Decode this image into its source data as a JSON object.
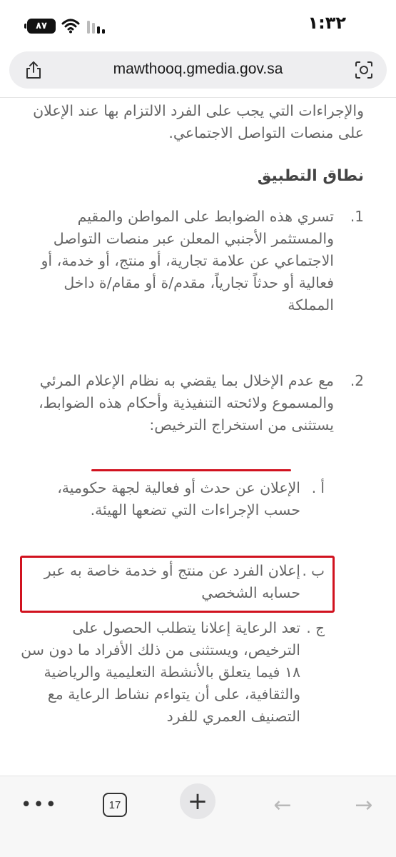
{
  "status": {
    "time": "١:٣٢",
    "battery": "٨٧"
  },
  "browser": {
    "url": "mawthooq.gmedia.gov.sa",
    "tab_count": "17",
    "more_label": "•••",
    "new_tab_label": "+",
    "back_label": "←",
    "forward_label": "→"
  },
  "article": {
    "intro": "والإجراءات التي يجب على الفرد الالتزام بها عند الإعلان على منصات التواصل الاجتماعي.",
    "heading": "نطاق التطبيق",
    "items": [
      {
        "num": "1.",
        "text": "تسري هذه الضوابط على المواطن والمقيم والمستثمر الأجنبي المعلن عبر منصات التواصل الاجتماعي عن علامة تجارية، أو منتج، أو خدمة، أو فعالية أو حدثاً تجارياً، مقدم/ة أو مقام/ة داخل المملكة"
      },
      {
        "num": "2.",
        "text": "مع عدم الإخلال بما يقضي به نظام الإعلام المرئي والمسموع ولائحته التنفيذية وأحكام هذه الضوابط، يستثنى من استخراج الترخيص:"
      }
    ],
    "sub_items": [
      {
        "num": "أ .",
        "text": "الإعلان عن حدث أو فعالية لجهة حكومية، حسب الإجراءات التي تضعها الهيئة."
      },
      {
        "num": "ب .",
        "text": "إعلان الفرد عن منتج أو خدمة خاصة به عبر حسابه الشخصي"
      },
      {
        "num": "ج .",
        "text": "تعد الرعاية إعلانا يتطلب الحصول على الترخيص، ويستثنى من ذلك الأفراد ما دون سن ١٨ فيما يتعلق بالأنشطة التعليمية والرياضية والثقافية، على أن يتواءم نشاط الرعاية مع التصنيف العمري للفرد"
      }
    ]
  },
  "colors": {
    "highlight": "#d1121f",
    "text": "#666666"
  }
}
